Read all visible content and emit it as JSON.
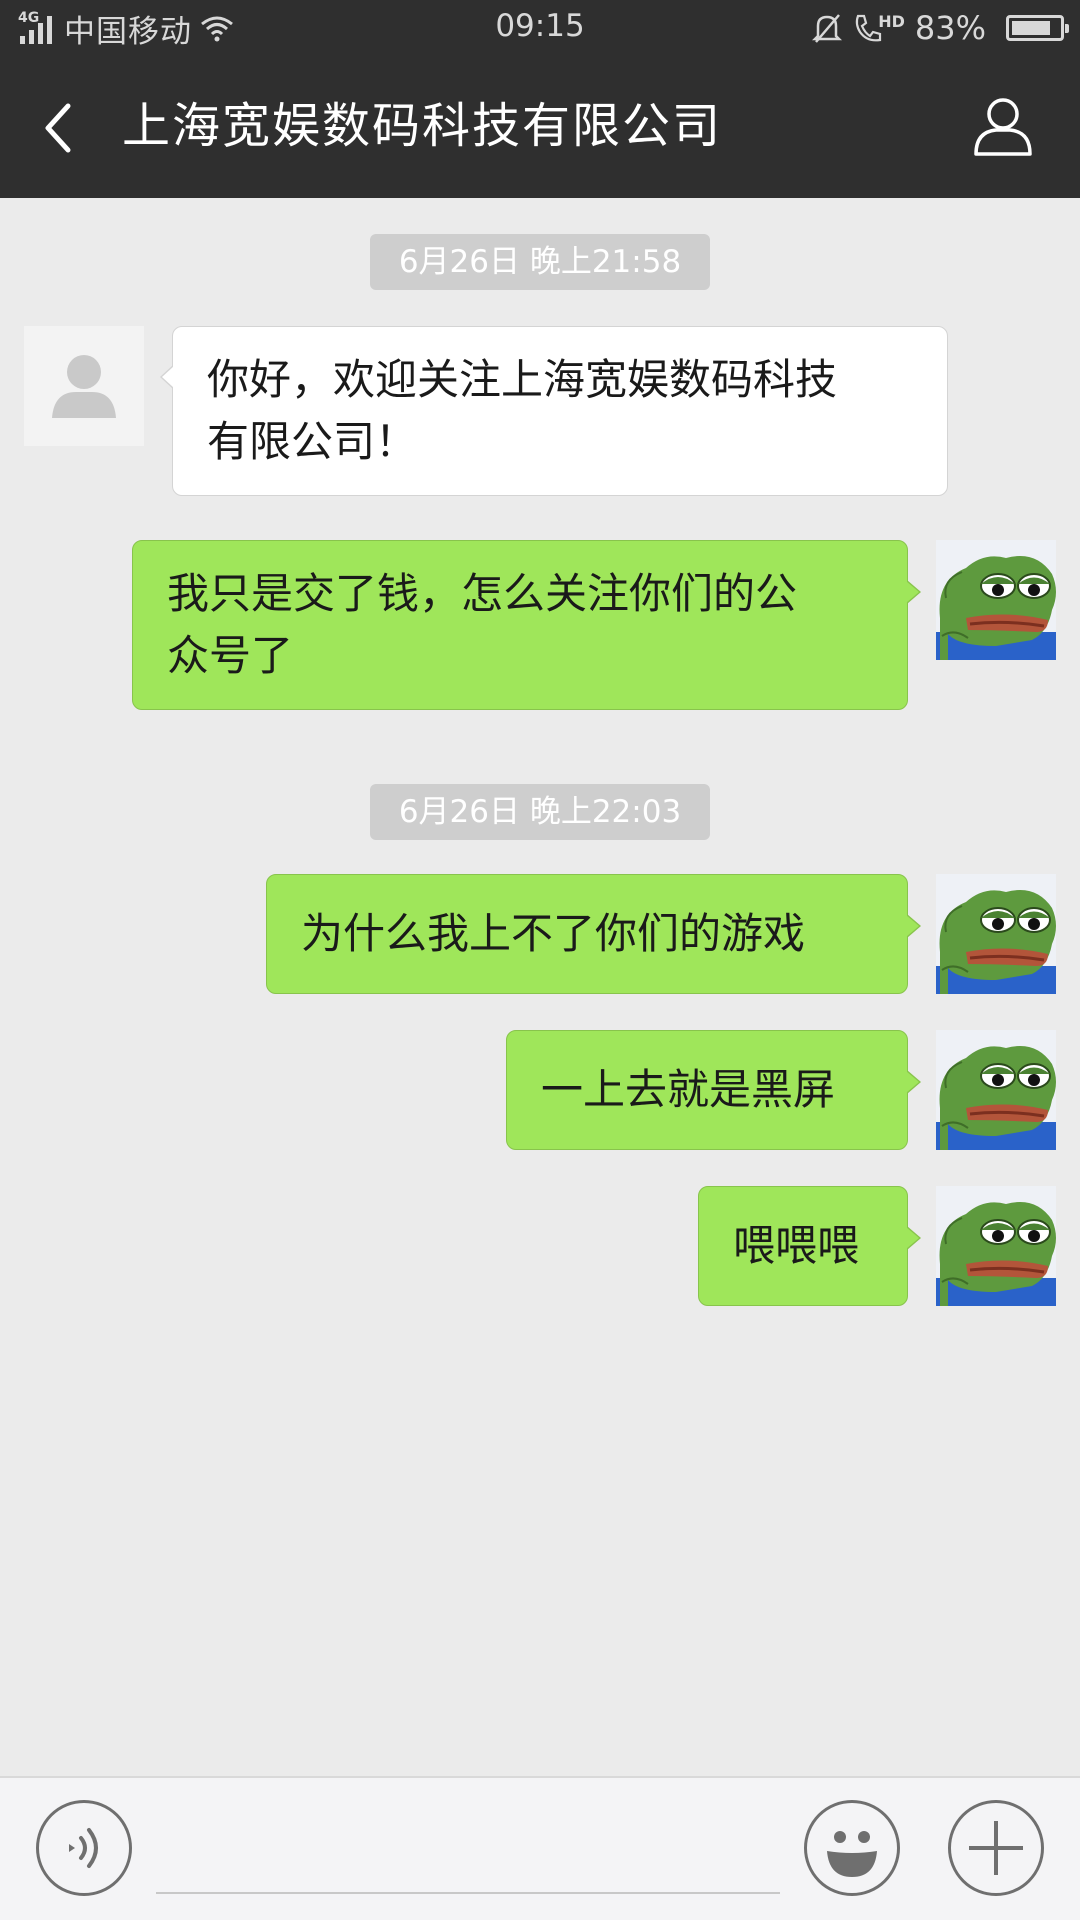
{
  "status_bar": {
    "network": "4G",
    "carrier": "中国移动",
    "time": "09:15",
    "hd_label": "HD",
    "battery_text": "83%",
    "battery_level": 0.83,
    "icons": [
      "signal-icon",
      "wifi-icon",
      "mute-bell-icon",
      "hd-call-icon",
      "battery-icon"
    ]
  },
  "header": {
    "title": "上海宽娱数码科技有限公司",
    "back_icon": "chevron-left-icon",
    "profile_icon": "person-icon",
    "background": "#2f2f2f"
  },
  "chat": {
    "background": "#ebebeb",
    "outgoing_bubble_color": "#9fe65a",
    "incoming_bubble_color": "#ffffff",
    "timestamps": [
      "6月26日 晚上21:58",
      "6月26日 晚上22:03"
    ],
    "messages": [
      {
        "side": "incoming",
        "avatar": "default-avatar-icon",
        "lines": [
          "你好，欢迎关注上海宽娱数码科技",
          "有限公司！"
        ]
      },
      {
        "side": "outgoing",
        "avatar": "frog-avatar",
        "lines": [
          "我只是交了钱，怎么关注你们的公",
          "众号了"
        ]
      },
      {
        "side": "outgoing",
        "avatar": "frog-avatar",
        "lines": [
          "为什么我上不了你们的游戏"
        ]
      },
      {
        "side": "outgoing",
        "avatar": "frog-avatar",
        "lines": [
          "一上去就是黑屏"
        ]
      },
      {
        "side": "outgoing",
        "avatar": "frog-avatar",
        "lines": [
          "喂喂喂"
        ]
      }
    ]
  },
  "input_bar": {
    "value": "",
    "icons": [
      "voice-icon",
      "emoji-icon",
      "plus-icon"
    ]
  }
}
